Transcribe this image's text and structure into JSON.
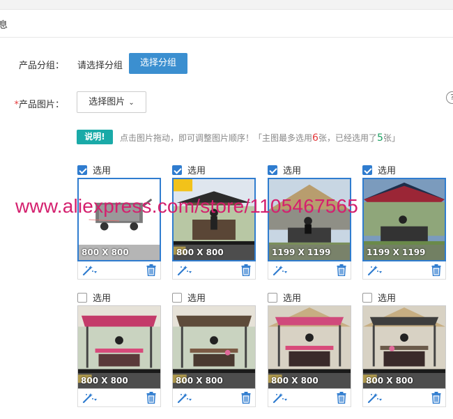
{
  "section": {
    "title": "息"
  },
  "group": {
    "label": "产品分组：",
    "value": "请选择分组",
    "button": "选择分组"
  },
  "images": {
    "required_mark": "*",
    "label": "产品图片：",
    "button": "选择图片",
    "caret": "⌄",
    "help": "?"
  },
  "tip": {
    "badge": "说明!",
    "text_a": "点击图片拖动，即可调整图片顺序！「主图最多选用",
    "max": "6",
    "text_b": "张，已经选用了",
    "used": "5",
    "text_c": "张」"
  },
  "colors": {
    "primary": "#3b8fd0",
    "teal": "#1aaaa8",
    "checked": "#2f7ccf",
    "watermark": "#d4206e"
  },
  "cards": [
    {
      "label": "选用",
      "checked": true,
      "size": "800 X 800",
      "icon": "product-cart-white"
    },
    {
      "label": "选用",
      "checked": true,
      "size": "800 X 800",
      "icon": "cart-with-model"
    },
    {
      "label": "选用",
      "checked": true,
      "size": "1199 X 1199",
      "icon": "tent-cart"
    },
    {
      "label": "选用",
      "checked": true,
      "size": "1199 X 1199",
      "icon": "red-canopy-cart"
    },
    {
      "label": "选用",
      "checked": false,
      "size": "800 X 800",
      "icon": "pink-canopy-table"
    },
    {
      "label": "选用",
      "checked": false,
      "size": "800 X 800",
      "icon": "brown-canopy-table"
    },
    {
      "label": "选用",
      "checked": false,
      "size": "800 X 800",
      "icon": "pink-canopy-tent"
    },
    {
      "label": "选用",
      "checked": false,
      "size": "800 X 800",
      "icon": "grey-canopy-tent"
    }
  ],
  "watermark": "www.aliexpress.com/store/1105467565"
}
